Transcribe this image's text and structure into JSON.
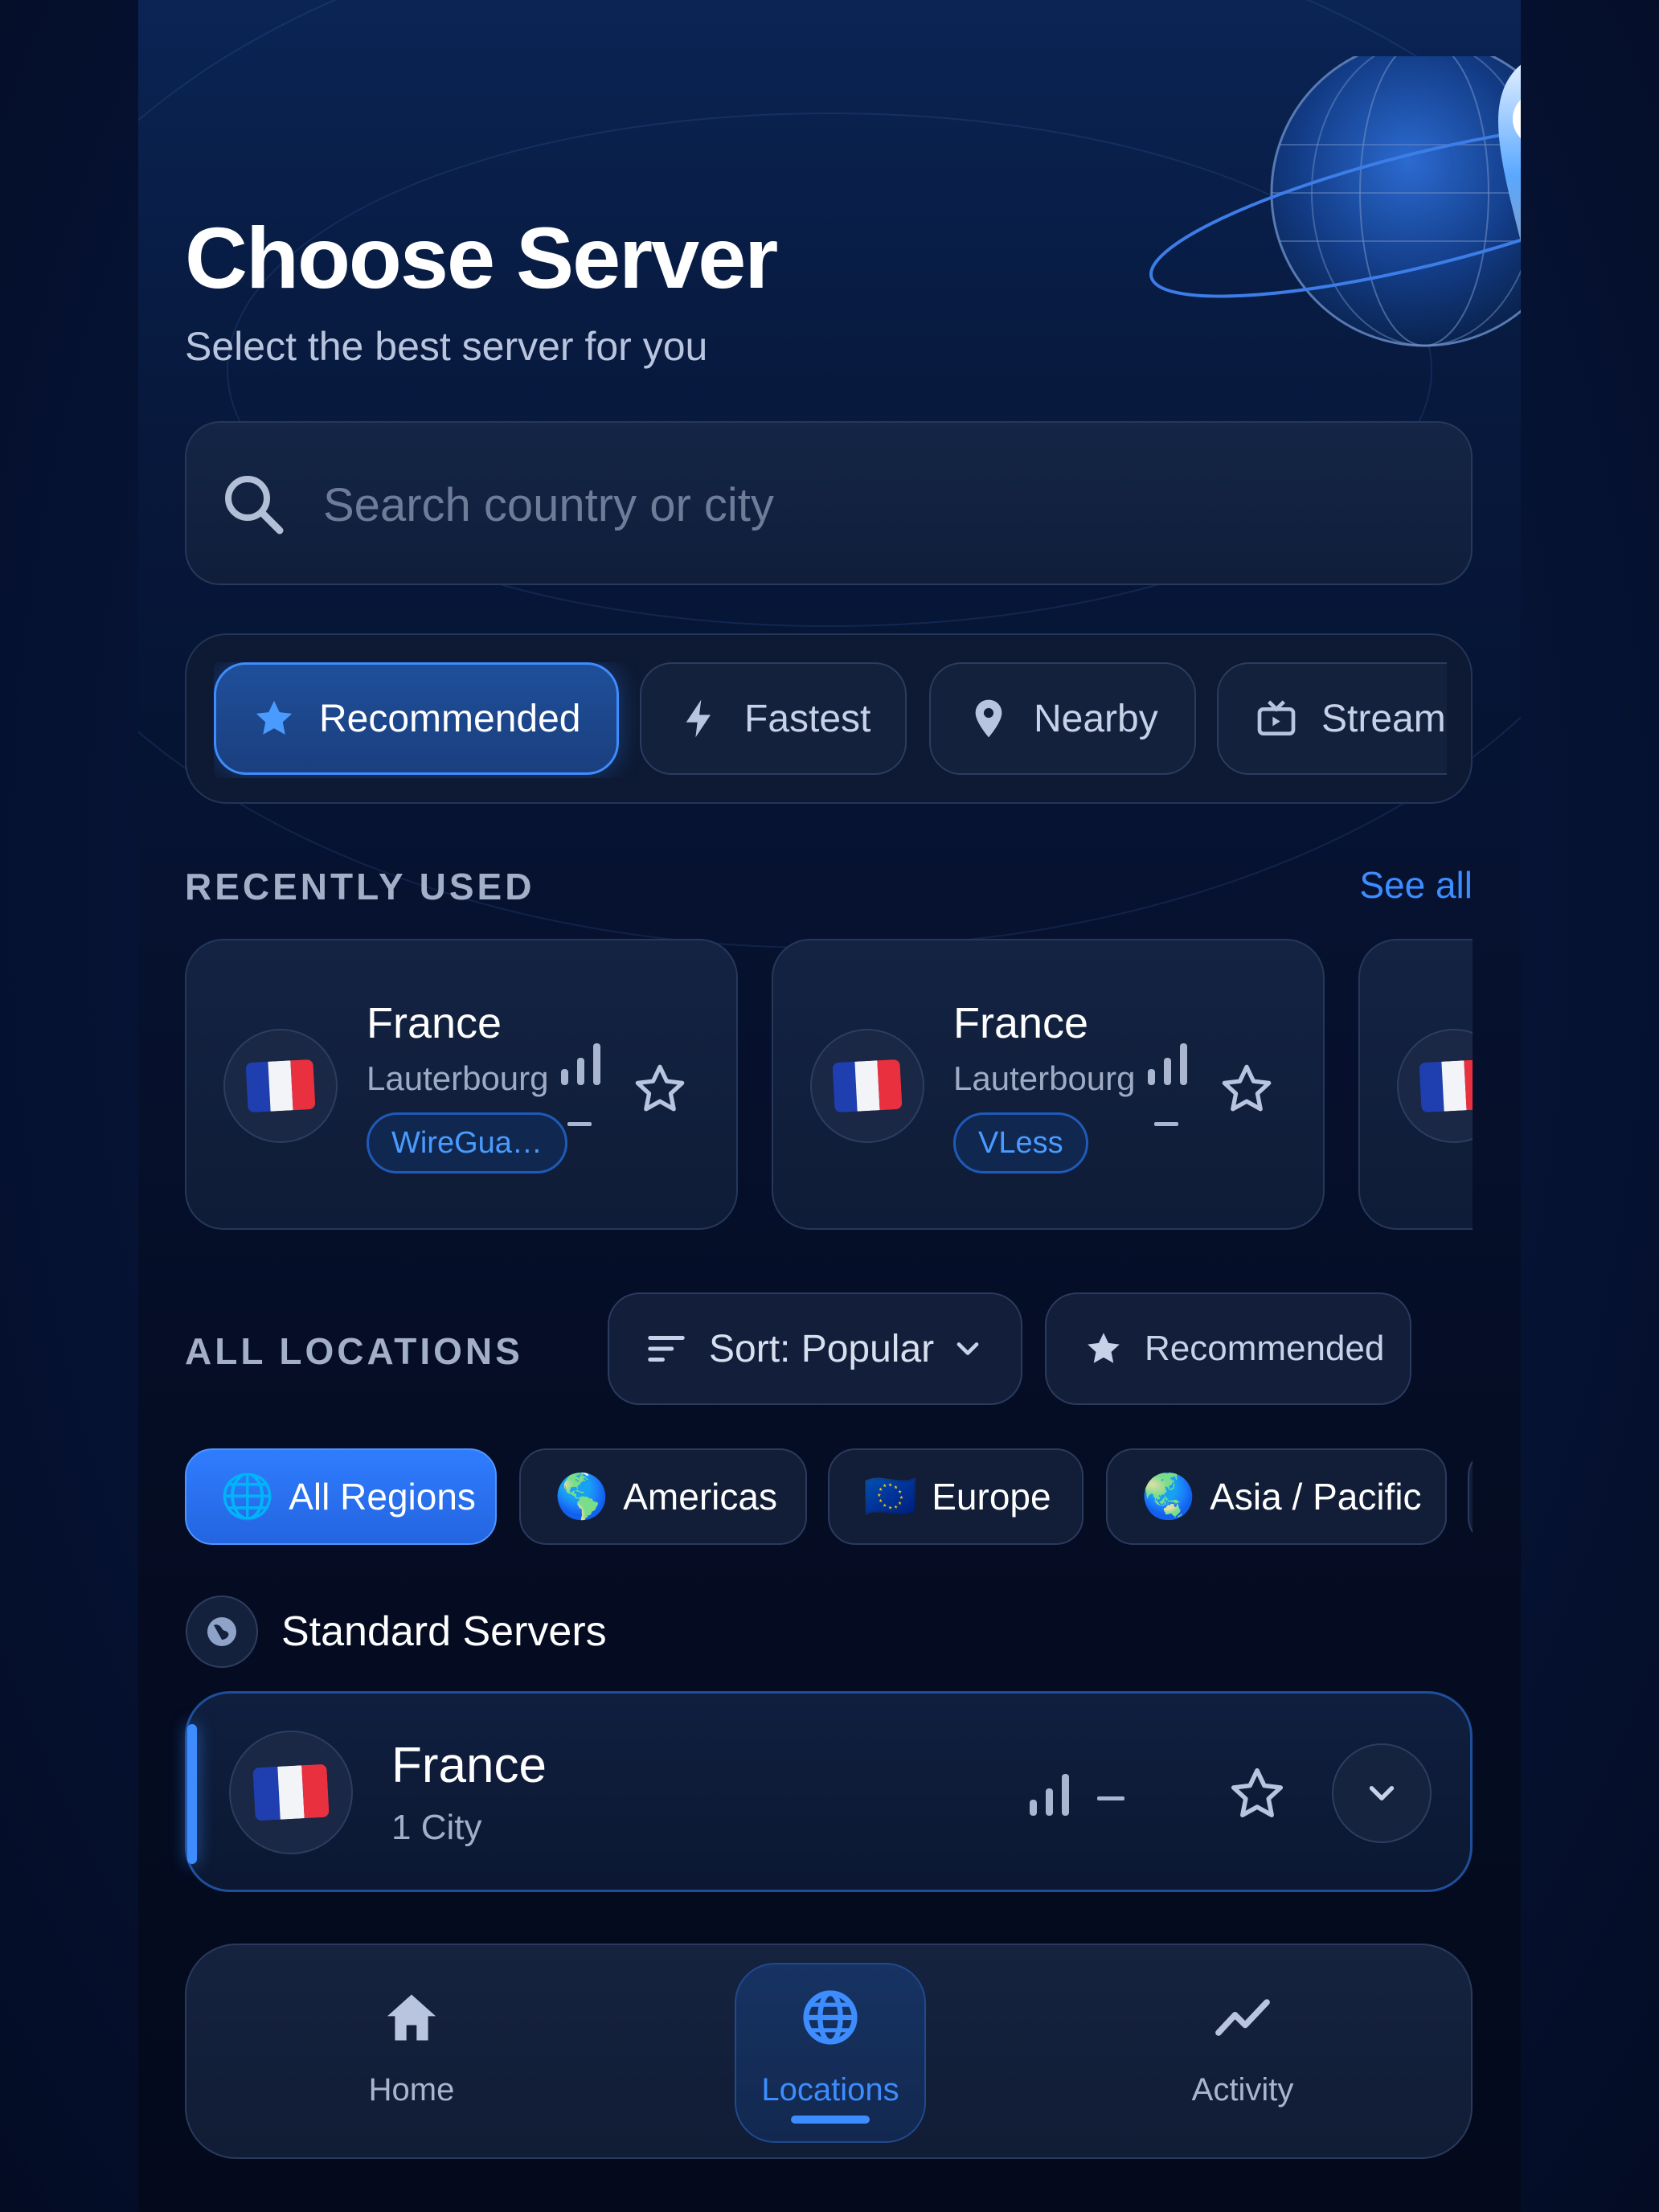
{
  "header": {
    "title": "Choose Server",
    "subtitle": "Select the best server for you"
  },
  "search": {
    "placeholder": "Search country or city",
    "value": ""
  },
  "filters": [
    {
      "label": "Recommended",
      "icon": "star-icon",
      "active": true
    },
    {
      "label": "Fastest",
      "icon": "bolt-icon",
      "active": false
    },
    {
      "label": "Nearby",
      "icon": "map-pin-icon",
      "active": false
    },
    {
      "label": "Stream",
      "icon": "tv-icon",
      "active": false
    }
  ],
  "recent": {
    "title": "RECENTLY USED",
    "see_all": "See all",
    "items": [
      {
        "country": "France",
        "city": "Lauterbourg",
        "protocol": "WireGua…",
        "ping": "–"
      },
      {
        "country": "France",
        "city": "Lauterbourg",
        "protocol": "VLess",
        "ping": "–"
      }
    ]
  },
  "locations": {
    "title": "ALL LOCATIONS",
    "sort_label": "Sort: Popular",
    "recommended_label": "Recommended",
    "regions": [
      {
        "label": "All Regions",
        "emoji": "🌐",
        "active": true
      },
      {
        "label": "Americas",
        "emoji": "🌎",
        "active": false
      },
      {
        "label": "Europe",
        "emoji": "🇪🇺",
        "active": false
      },
      {
        "label": "Asia / Pacific",
        "emoji": "🌏",
        "active": false
      }
    ]
  },
  "standard": {
    "title": "Standard Servers",
    "servers": [
      {
        "country": "France",
        "cities": "1 City",
        "ping": "–"
      }
    ]
  },
  "nav": {
    "home": "Home",
    "locations": "Locations",
    "activity": "Activity",
    "active": "locations"
  },
  "colors": {
    "accent": "#3d8dff",
    "background": "#061230",
    "card": "#132342"
  }
}
